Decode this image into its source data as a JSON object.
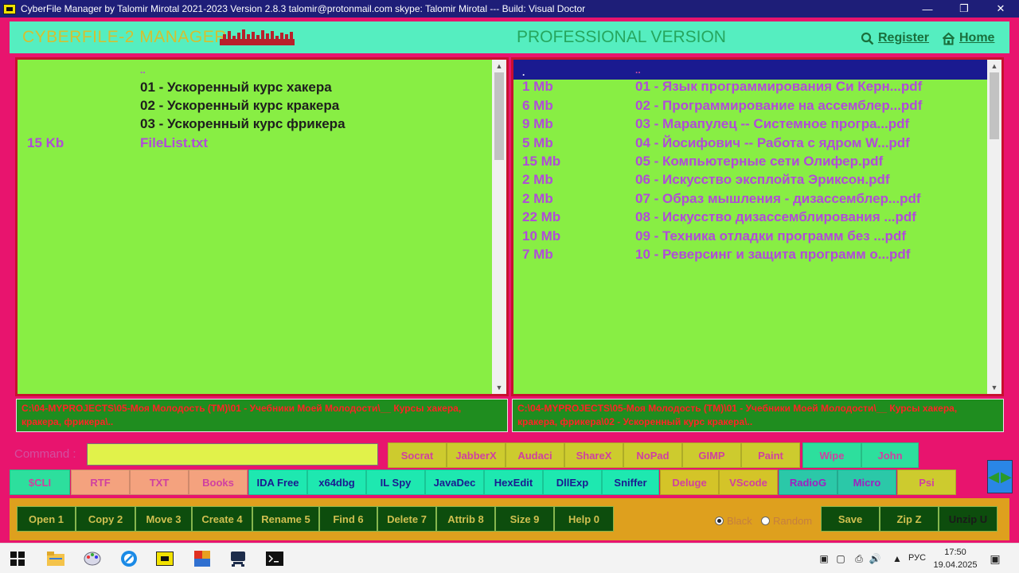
{
  "window": {
    "title": "CyberFile Manager by Talomir Mirotal 2021-2023 Version 2.8.3    talomir@protonmail.com   skype: Talomir Mirotal --- Build: Visual Doctor"
  },
  "header": {
    "brand": "CYBERFILE-2 MANAGER",
    "edition": "PROFESSIONAL VERSION",
    "register": "Register",
    "home": "Home"
  },
  "left_panel": {
    "parent": "..",
    "rows": [
      {
        "size": "",
        "name": "01 - Ускоренный курс хакера",
        "kind": "folder"
      },
      {
        "size": "",
        "name": "02 - Ускоренный курс кракера",
        "kind": "folder"
      },
      {
        "size": "",
        "name": "03 - Ускоренный курс фрикера",
        "kind": "folder"
      },
      {
        "size": "15 Kb",
        "name": "FileList.txt",
        "kind": "file"
      }
    ],
    "path": "C:\\04-MYPROJECTS\\05-Моя Молодость (TM)\\01 - Учебники Моей Молодости\\__ Курсы хакера, кракера, фрикера\\.."
  },
  "right_panel": {
    "selected_size": ".",
    "parent": "..",
    "rows": [
      {
        "size": "1 Mb",
        "name": "01 - Язык программирования Си Керн...pdf"
      },
      {
        "size": "6 Mb",
        "name": "02 - Программирование на ассемблер...pdf"
      },
      {
        "size": "9 Mb",
        "name": "03 - Марапулец -- Системное програ...pdf"
      },
      {
        "size": "5 Mb",
        "name": "04 - Йосифович -- Работа с ядром W...pdf"
      },
      {
        "size": "15 Mb",
        "name": "05 - Компьютерные сети Олифер.pdf"
      },
      {
        "size": "2 Mb",
        "name": "06 - Искусство эксплойта Эриксон.pdf"
      },
      {
        "size": "2 Mb",
        "name": "07 - Образ мышления - дизассемблер...pdf"
      },
      {
        "size": "22 Mb",
        "name": "08 - Искусство дизассемблирования ...pdf"
      },
      {
        "size": "10 Mb",
        "name": "09 - Техника отладки программ без ...pdf"
      },
      {
        "size": "7 Mb",
        "name": "10 - Реверсинг и защита программ о...pdf"
      }
    ],
    "path": "C:\\04-MYPROJECTS\\05-Моя Молодость (TM)\\01 - Учебники Моей Молодости\\__ Курсы хакера, кракера, фрикера\\02 - Ускоренный курс кракера\\.."
  },
  "command": {
    "label": "Command :",
    "value": ""
  },
  "tools_row1": [
    "Socrat",
    "JabberX",
    "Audaci",
    "ShareX",
    "NoPad",
    "GIMP",
    "Paint",
    "Wipe",
    "John"
  ],
  "tools_row2": [
    "$CLI",
    "RTF",
    "TXT",
    "Books",
    "IDA Free",
    "x64dbg",
    "IL Spy",
    "JavaDec",
    "HexEdit",
    "DllExp",
    "Sniffer",
    "Deluge",
    "VScode",
    "RadioG",
    "Micro",
    "Psi"
  ],
  "function_keys": [
    "Open 1",
    "Copy 2",
    "Move 3",
    "Create 4",
    "Rename 5",
    "Find 6",
    "Delete 7",
    "Attrib 8",
    "Size 9",
    "Help 0"
  ],
  "theme": {
    "options": [
      "Black",
      "Random"
    ],
    "selected": "Black"
  },
  "actions": [
    "Save",
    "Zip Z",
    "Unzip U"
  ],
  "taskbar": {
    "apps": [
      "windows-start",
      "file-explorer",
      "paint-app",
      "browser",
      "cyberfile",
      "media-app",
      "terminal-app",
      "console"
    ],
    "lang": "РУС",
    "time": "17:50",
    "date": "19.04.2025"
  },
  "colors": {
    "background": "#e8146e",
    "panel": "#88ee44",
    "header": "#55eec0",
    "function_bar": "#dea01e",
    "path_bar": "#1f8d1f"
  }
}
